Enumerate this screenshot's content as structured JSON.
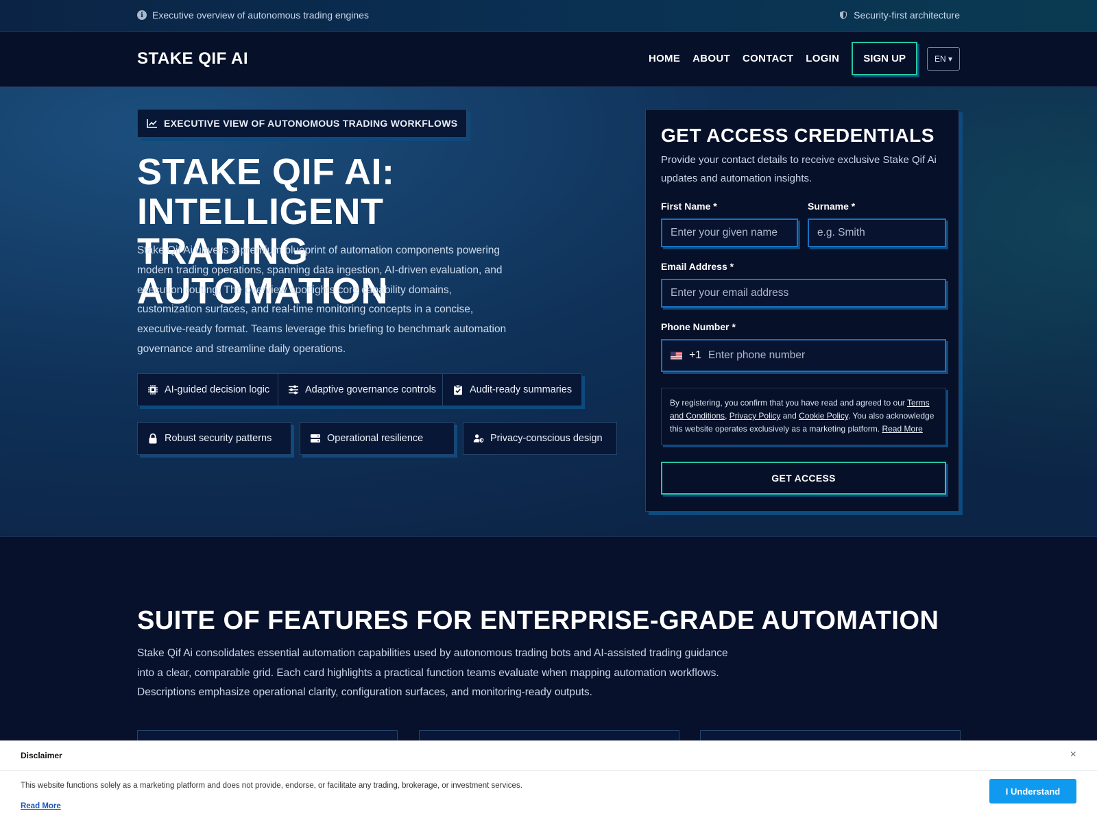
{
  "topbar": {
    "left_text": "Executive overview of autonomous trading engines",
    "right_text": "Security-first architecture"
  },
  "nav": {
    "brand": "STAKE QIF AI",
    "links": [
      "HOME",
      "ABOUT",
      "CONTACT",
      "LOGIN"
    ],
    "signup": "SIGN UP",
    "language": "EN ▾"
  },
  "hero": {
    "eyebrow": "EXECUTIVE VIEW OF AUTONOMOUS TRADING WORKFLOWS",
    "title": "STAKE QIF AI: INTELLIGENT TRADING AUTOMATION",
    "description": "Stake Qif Ai unveils a premium blueprint of automation components powering modern trading operations, spanning data ingestion, AI-driven evaluation, and execution routing. The overview spotlights core capability domains, customization surfaces, and real-time monitoring concepts in a concise, executive-ready format. Teams leverage this briefing to benchmark automation governance and streamline daily operations.",
    "chips": [
      {
        "label": "AI-guided decision logic",
        "icon": "chip-icon"
      },
      {
        "label": "Adaptive governance controls",
        "icon": "sliders-icon"
      },
      {
        "label": "Audit-ready summaries",
        "icon": "clipboard-check-icon"
      },
      {
        "label": "Robust security patterns",
        "icon": "lock-icon"
      },
      {
        "label": "Operational resilience",
        "icon": "server-icon"
      },
      {
        "label": "Privacy-conscious design",
        "icon": "user-shield-icon"
      }
    ]
  },
  "form": {
    "title": "GET ACCESS CREDENTIALS",
    "subtitle": "Provide your contact details to receive exclusive Stake Qif Ai updates and automation insights.",
    "first_name_label": "First Name *",
    "first_name_placeholder": "Enter your given name",
    "surname_label": "Surname *",
    "surname_placeholder": "e.g. Smith",
    "email_label": "Email Address *",
    "email_placeholder": "Enter your email address",
    "phone_label": "Phone Number *",
    "phone_dial": "+1",
    "phone_placeholder": "Enter phone number",
    "consent": {
      "pre": "By registering, you confirm that you have read and agreed to our ",
      "terms": "Terms and Conditions",
      "sep1": ", ",
      "privacy": "Privacy Policy",
      "and": " and ",
      "cookie": "Cookie Policy",
      "post": ". You also acknowledge this website operates exclusively as a marketing platform. ",
      "read_more": "Read More"
    },
    "submit": "GET ACCESS"
  },
  "features": {
    "title": "SUITE OF FEATURES FOR ENTERPRISE-GRADE AUTOMATION",
    "description": "Stake Qif Ai consolidates essential automation capabilities used by autonomous trading bots and AI-assisted trading guidance into a clear, comparable grid. Each card highlights a practical function teams evaluate when mapping automation workflows. Descriptions emphasize operational clarity, configuration surfaces, and monitoring-ready outputs."
  },
  "disclaimer": {
    "title": "Disclaimer",
    "text": "This website functions solely as a marketing platform and does not provide, endorse, or facilitate any trading, brokerage, or investment services.",
    "read_more": "Read More",
    "button": "I Understand",
    "close": "×"
  },
  "colors": {
    "accent_green": "#27c7a2",
    "accent_blue": "#1872c0",
    "background": "#07112b",
    "button_blue": "#0f9af0"
  }
}
